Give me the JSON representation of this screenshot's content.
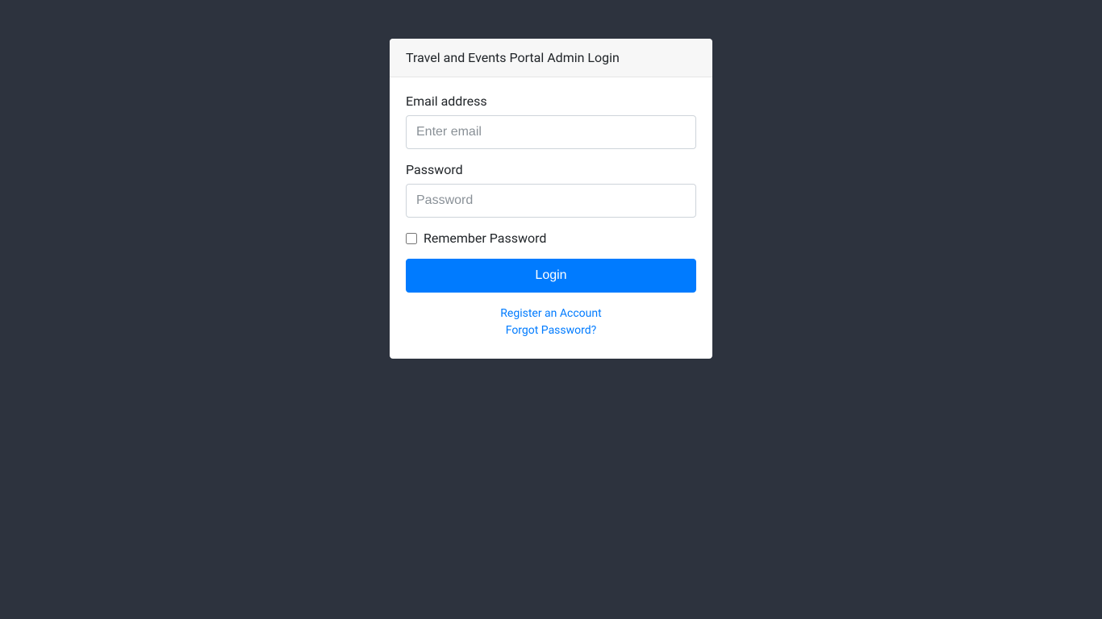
{
  "card": {
    "title": "Travel and Events Portal Admin Login"
  },
  "form": {
    "email": {
      "label": "Email address",
      "placeholder": "Enter email",
      "value": ""
    },
    "password": {
      "label": "Password",
      "placeholder": "Password",
      "value": ""
    },
    "remember": {
      "label": "Remember Password"
    },
    "submit": {
      "label": "Login"
    }
  },
  "links": {
    "register": "Register an Account",
    "forgot": "Forgot Password?"
  }
}
